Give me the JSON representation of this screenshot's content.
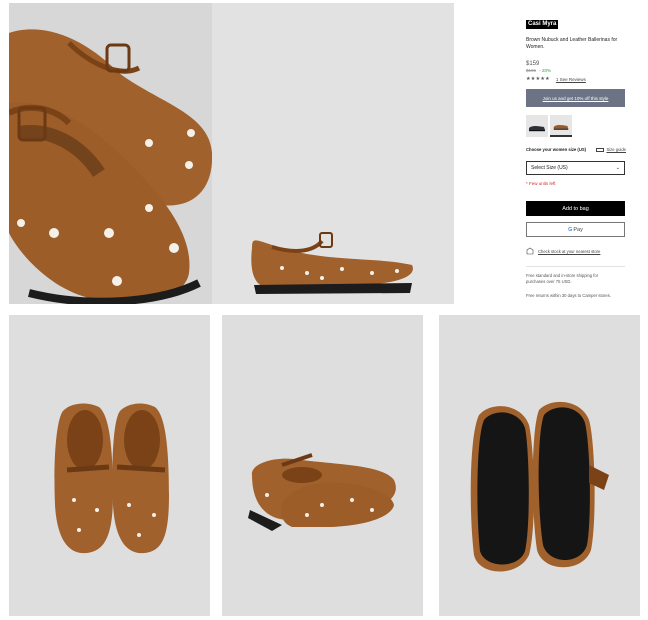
{
  "product": {
    "brand": "Casi Myra",
    "description": "Brown Nubuck and Leather Ballerinas for Women.",
    "price": "$159",
    "old_price": "$165",
    "discount": "- 20%",
    "stars": "★★★★★",
    "rating_value": 5,
    "reviews_label": "1 See Reviews"
  },
  "promo": {
    "label": "Join us and get 10% off this style"
  },
  "swatches": [
    {
      "name": "black",
      "color": "#2b2f36",
      "selected": false
    },
    {
      "name": "brown",
      "color": "#9a5a2a",
      "selected": true
    }
  ],
  "size": {
    "label": "Choose your women size (US)",
    "guide_label": "Size guide",
    "select_value": "Select Size (US)",
    "stock_note": "* Few units left"
  },
  "actions": {
    "add_to_bag": "Add to bag",
    "gpay_g": "G",
    "gpay_text": " Pay",
    "store_check": "Check stock at your nearest store"
  },
  "info": {
    "shipping": "Free standard and in-store shipping for purchases over 75 USD.",
    "returns": "Free returns within 30 days to Camper stores."
  },
  "colors": {
    "leather": "#a0612c",
    "leather_dark": "#7a4216",
    "sole": "#1c1c1c",
    "promo_bg": "#6c7384",
    "alert": "#d62b2b"
  },
  "images": [
    {
      "name": "img-main",
      "icon": "shoe-closeup-photo"
    },
    {
      "name": "img-side",
      "icon": "shoe-side-photo"
    },
    {
      "name": "img-top",
      "icon": "shoe-top-photo"
    },
    {
      "name": "img-back",
      "icon": "shoe-back-photo"
    },
    {
      "name": "img-sole",
      "icon": "shoe-sole-photo"
    }
  ]
}
